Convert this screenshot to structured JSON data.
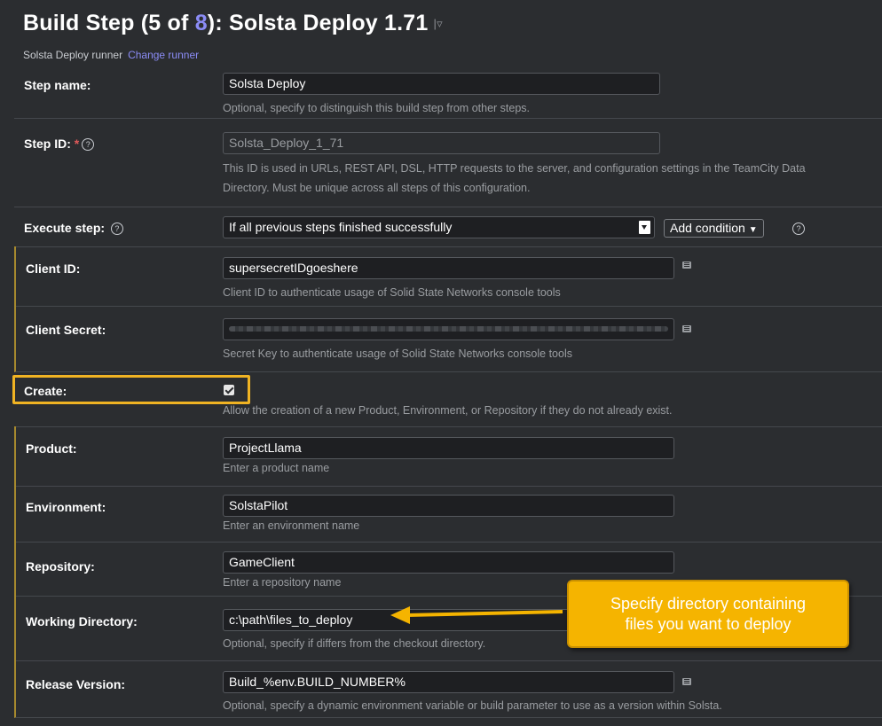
{
  "header": {
    "title_prefix": "Build Step (",
    "step_current": "5",
    "of_word": " of ",
    "step_total": "8",
    "title_suffix": "): Solsta Deploy 1.71",
    "runner_name": "Solsta Deploy runner",
    "change_runner": "Change runner"
  },
  "step_name": {
    "label": "Step name:",
    "value": "Solsta Deploy",
    "hint": "Optional, specify to distinguish this build step from other steps."
  },
  "step_id": {
    "label": "Step ID:",
    "required_mark": "*",
    "value": "Solsta_Deploy_1_71",
    "hint_line1": "This ID is used in URLs, REST API, DSL, HTTP requests to the server, and configuration settings in the TeamCity Data",
    "hint_line2": "Directory. Must be unique across all steps of this configuration."
  },
  "execute_step": {
    "label": "Execute step:",
    "value": "If all previous steps finished successfully",
    "add_condition": "Add condition"
  },
  "client_id": {
    "label": "Client ID:",
    "value": "supersecretIDgoeshere",
    "hint": "Client ID to authenticate usage of Solid State Networks console tools"
  },
  "client_secret": {
    "label": "Client Secret:",
    "hint": "Secret Key to authenticate usage of Solid State Networks console tools"
  },
  "create": {
    "label": "Create:",
    "checked": true,
    "hint": "Allow the creation of a new Product, Environment, or Repository if they do not already exist."
  },
  "product": {
    "label": "Product:",
    "value": "ProjectLlama",
    "hint": "Enter a product name"
  },
  "environment": {
    "label": "Environment:",
    "value": "SolstaPilot",
    "hint": "Enter an environment name"
  },
  "repository": {
    "label": "Repository:",
    "value": "GameClient",
    "hint": "Enter a repository name"
  },
  "working_directory": {
    "label": "Working Directory:",
    "value": "c:\\path\\files_to_deploy",
    "hint": "Optional, specify if differs from the checkout directory."
  },
  "release_version": {
    "label": "Release Version:",
    "value": "Build_%env.BUILD_NUMBER%",
    "hint": "Optional, specify a dynamic environment variable or build parameter to use as a version within Solsta."
  },
  "callout": {
    "line1": "Specify directory containing",
    "line2": "files you want to deploy"
  },
  "help_glyph": "?",
  "colors": {
    "accent": "#8b8cf6",
    "highlight": "#f0b323",
    "callout": "#f5b400",
    "section_bar": "#a6892e"
  }
}
